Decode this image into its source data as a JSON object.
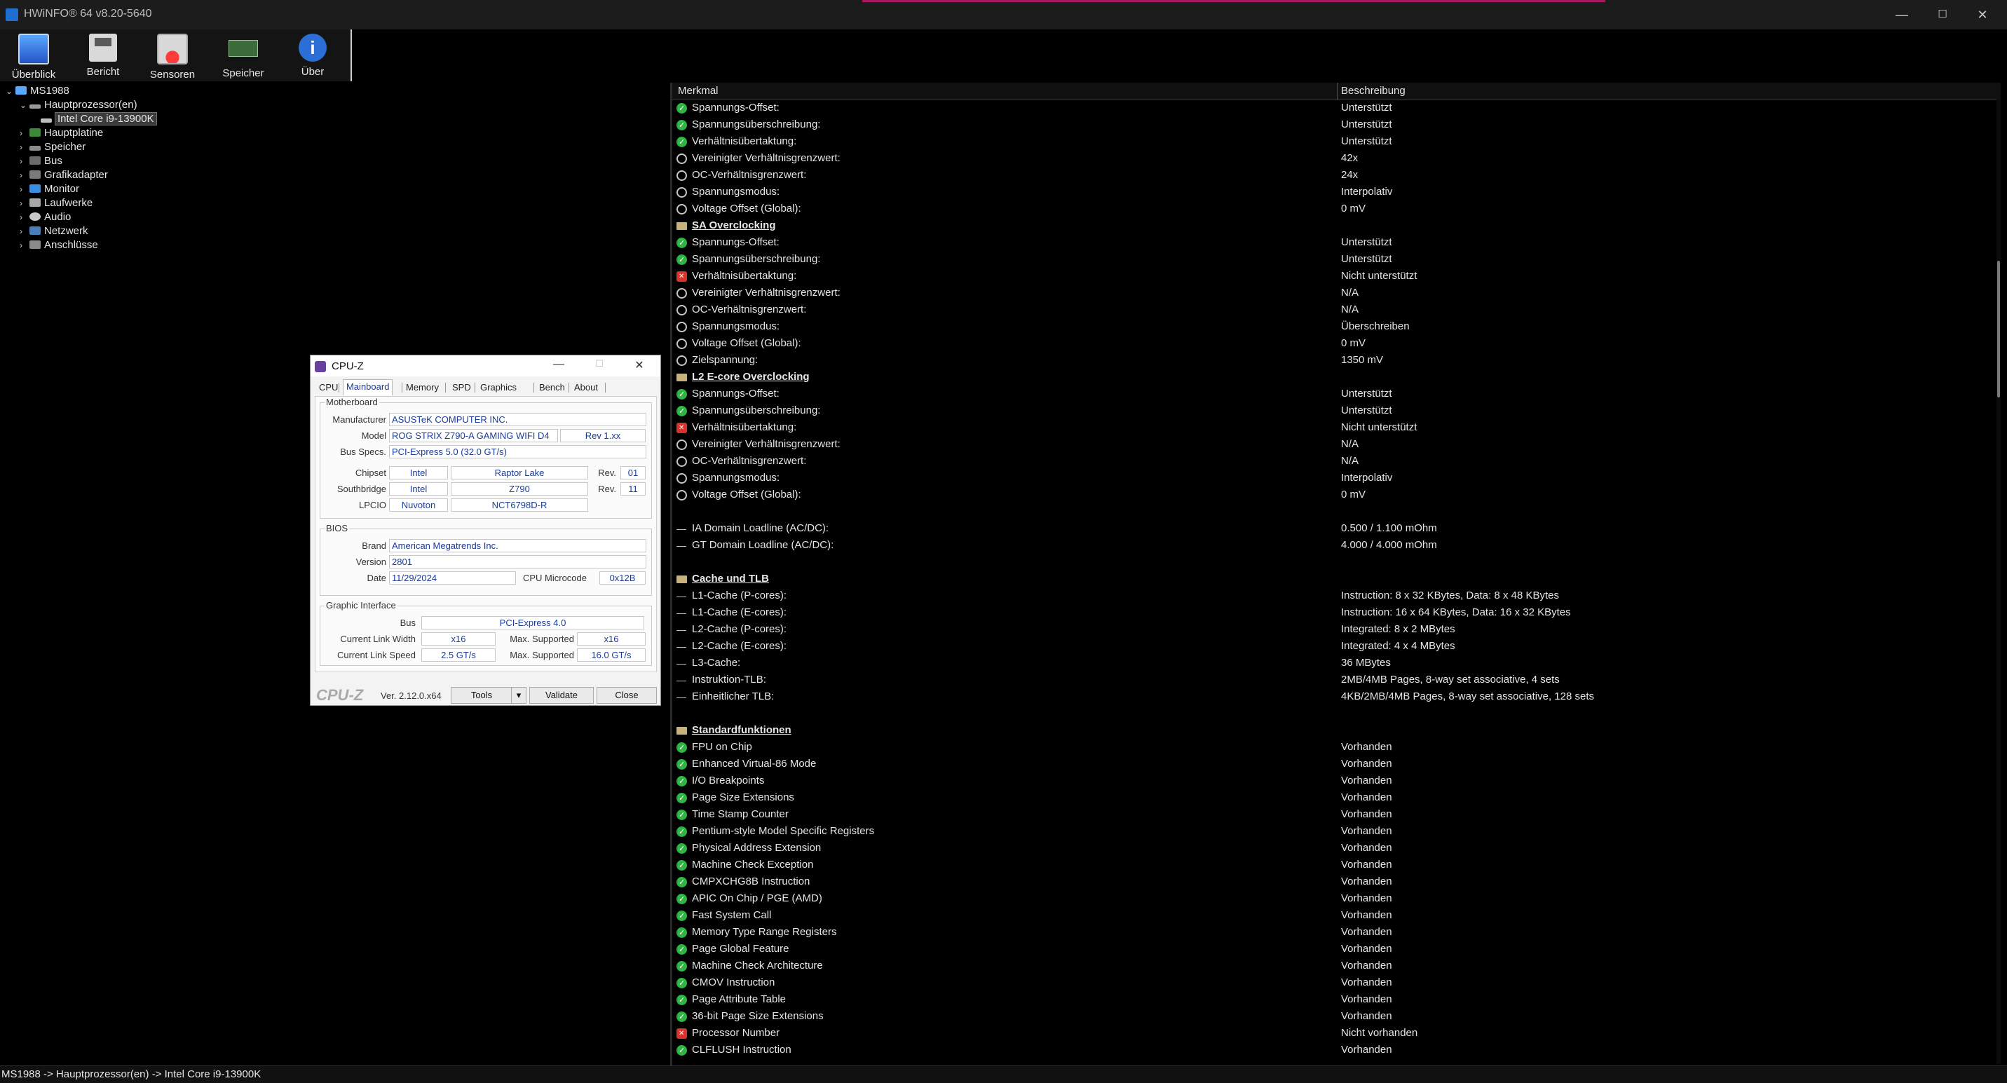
{
  "window": {
    "title": "HWiNFO® 64 v8.20-5640",
    "controls": {
      "minimize": "—",
      "maximize": "☐",
      "close": "✕"
    }
  },
  "toolbar": {
    "buttons": [
      {
        "label": "Überblick",
        "icon": "overview-icon"
      },
      {
        "label": "Bericht",
        "icon": "report-icon"
      },
      {
        "label": "Sensoren",
        "icon": "sensor-icon"
      },
      {
        "label": "Speicher",
        "icon": "memory-icon"
      },
      {
        "label": "Über",
        "icon": "about-icon",
        "glyph": "i"
      }
    ]
  },
  "tree": {
    "nodes": [
      {
        "label": "MS1988",
        "exp": "⌄"
      },
      {
        "label": "Hauptprozessor(en)",
        "exp": "⌄"
      },
      {
        "label": "Intel Core i9-13900K",
        "exp": ""
      },
      {
        "label": "Hauptplatine",
        "exp": "›"
      },
      {
        "label": "Speicher",
        "exp": "›"
      },
      {
        "label": "Bus",
        "exp": "›"
      },
      {
        "label": "Grafikadapter",
        "exp": "›"
      },
      {
        "label": "Monitor",
        "exp": "›"
      },
      {
        "label": "Laufwerke",
        "exp": "›"
      },
      {
        "label": "Audio",
        "exp": "›"
      },
      {
        "label": "Netzwerk",
        "exp": "›"
      },
      {
        "label": "Anschlüsse",
        "exp": "›"
      }
    ]
  },
  "table": {
    "headers": {
      "feature": "Merkmal",
      "description": "Beschreibung"
    },
    "rows": [
      {
        "icon": "ok",
        "k": "Spannungs-Offset:",
        "v": "Unterstützt"
      },
      {
        "icon": "ok",
        "k": "Spannungsüberschreibung:",
        "v": "Unterstützt"
      },
      {
        "icon": "ok",
        "k": "Verhältnisübertaktung:",
        "v": "Unterstützt"
      },
      {
        "icon": "clock",
        "k": "Vereinigter Verhältnisgrenzwert:",
        "v": "42x"
      },
      {
        "icon": "clock",
        "k": "OC-Verhältnisgrenzwert:",
        "v": "24x"
      },
      {
        "icon": "clock",
        "k": "Spannungsmodus:",
        "v": "Interpolativ"
      },
      {
        "icon": "clock",
        "k": "Voltage Offset (Global):",
        "v": "0 mV"
      },
      {
        "icon": "folder",
        "k": "SA Overclocking",
        "v": "",
        "section": true
      },
      {
        "icon": "ok",
        "k": "Spannungs-Offset:",
        "v": "Unterstützt"
      },
      {
        "icon": "ok",
        "k": "Spannungsüberschreibung:",
        "v": "Unterstützt"
      },
      {
        "icon": "no",
        "k": "Verhältnisübertaktung:",
        "v": "Nicht unterstützt"
      },
      {
        "icon": "clock",
        "k": "Vereinigter Verhältnisgrenzwert:",
        "v": "N/A"
      },
      {
        "icon": "clock",
        "k": "OC-Verhältnisgrenzwert:",
        "v": "N/A"
      },
      {
        "icon": "clock",
        "k": "Spannungsmodus:",
        "v": "Überschreiben"
      },
      {
        "icon": "clock",
        "k": "Voltage Offset (Global):",
        "v": "0 mV"
      },
      {
        "icon": "clock",
        "k": "Zielspannung:",
        "v": "1350 mV"
      },
      {
        "icon": "folder",
        "k": "L2 E-core Overclocking",
        "v": "",
        "section": true
      },
      {
        "icon": "ok",
        "k": "Spannungs-Offset:",
        "v": "Unterstützt"
      },
      {
        "icon": "ok",
        "k": "Spannungsüberschreibung:",
        "v": "Unterstützt"
      },
      {
        "icon": "no",
        "k": "Verhältnisübertaktung:",
        "v": "Nicht unterstützt"
      },
      {
        "icon": "clock",
        "k": "Vereinigter Verhältnisgrenzwert:",
        "v": "N/A"
      },
      {
        "icon": "clock",
        "k": "OC-Verhältnisgrenzwert:",
        "v": "N/A"
      },
      {
        "icon": "clock",
        "k": "Spannungsmodus:",
        "v": "Interpolativ"
      },
      {
        "icon": "clock",
        "k": "Voltage Offset (Global):",
        "v": "0 mV"
      },
      {
        "icon": "blank",
        "k": "",
        "v": ""
      },
      {
        "icon": "dash",
        "k": "IA Domain Loadline (AC/DC):",
        "v": "0.500 / 1.100 mOhm"
      },
      {
        "icon": "dash",
        "k": "GT Domain Loadline (AC/DC):",
        "v": "4.000 / 4.000 mOhm"
      },
      {
        "icon": "blank",
        "k": "",
        "v": ""
      },
      {
        "icon": "folder",
        "k": "Cache und TLB",
        "v": "",
        "section": true
      },
      {
        "icon": "dash",
        "k": "L1-Cache (P-cores):",
        "v": "Instruction: 8 x 32 KBytes, Data: 8 x 48 KBytes"
      },
      {
        "icon": "dash",
        "k": "L1-Cache (E-cores):",
        "v": "Instruction: 16 x 64 KBytes, Data: 16 x 32 KBytes"
      },
      {
        "icon": "dash",
        "k": "L2-Cache (P-cores):",
        "v": "Integrated: 8 x 2 MBytes"
      },
      {
        "icon": "dash",
        "k": "L2-Cache (E-cores):",
        "v": "Integrated: 4 x 4 MBytes"
      },
      {
        "icon": "dash",
        "k": "L3-Cache:",
        "v": "36 MBytes"
      },
      {
        "icon": "dash",
        "k": "Instruktion-TLB:",
        "v": "2MB/4MB Pages, 8-way set associative, 4 sets"
      },
      {
        "icon": "dash",
        "k": "Einheitlicher TLB:",
        "v": "4KB/2MB/4MB Pages, 8-way set associative, 128 sets"
      },
      {
        "icon": "blank",
        "k": "",
        "v": ""
      },
      {
        "icon": "folder",
        "k": "Standardfunktionen",
        "v": "",
        "section": true
      },
      {
        "icon": "ok",
        "k": "FPU on Chip",
        "v": "Vorhanden"
      },
      {
        "icon": "ok",
        "k": "Enhanced Virtual-86 Mode",
        "v": "Vorhanden"
      },
      {
        "icon": "ok",
        "k": "I/O Breakpoints",
        "v": "Vorhanden"
      },
      {
        "icon": "ok",
        "k": "Page Size Extensions",
        "v": "Vorhanden"
      },
      {
        "icon": "ok",
        "k": "Time Stamp Counter",
        "v": "Vorhanden"
      },
      {
        "icon": "ok",
        "k": "Pentium-style Model Specific Registers",
        "v": "Vorhanden"
      },
      {
        "icon": "ok",
        "k": "Physical Address Extension",
        "v": "Vorhanden"
      },
      {
        "icon": "ok",
        "k": "Machine Check Exception",
        "v": "Vorhanden"
      },
      {
        "icon": "ok",
        "k": "CMPXCHG8B Instruction",
        "v": "Vorhanden"
      },
      {
        "icon": "ok",
        "k": "APIC On Chip / PGE (AMD)",
        "v": "Vorhanden"
      },
      {
        "icon": "ok",
        "k": "Fast System Call",
        "v": "Vorhanden"
      },
      {
        "icon": "ok",
        "k": "Memory Type Range Registers",
        "v": "Vorhanden"
      },
      {
        "icon": "ok",
        "k": "Page Global Feature",
        "v": "Vorhanden"
      },
      {
        "icon": "ok",
        "k": "Machine Check Architecture",
        "v": "Vorhanden"
      },
      {
        "icon": "ok",
        "k": "CMOV Instruction",
        "v": "Vorhanden"
      },
      {
        "icon": "ok",
        "k": "Page Attribute Table",
        "v": "Vorhanden"
      },
      {
        "icon": "ok",
        "k": "36-bit Page Size Extensions",
        "v": "Vorhanden"
      },
      {
        "icon": "no",
        "k": "Processor Number",
        "v": "Nicht vorhanden"
      },
      {
        "icon": "ok",
        "k": "CLFLUSH Instruction",
        "v": "Vorhanden"
      }
    ]
  },
  "statusbar": {
    "path": "MS1988 -> Hauptprozessor(en) -> Intel Core i9-13900K"
  },
  "cpuz": {
    "title": "CPU-Z",
    "controls": {
      "minimize": "—",
      "maximize": "☐",
      "close": "✕"
    },
    "tabs": [
      "CPU",
      "Mainboard",
      "Memory",
      "SPD",
      "Graphics",
      "Bench",
      "About"
    ],
    "active_tab": "Mainboard",
    "motherboard": {
      "group": "Motherboard",
      "manufacturer_label": "Manufacturer",
      "manufacturer": "ASUSTeK COMPUTER INC.",
      "model_label": "Model",
      "model": "ROG STRIX Z790-A GAMING WIFI D4",
      "model_rev": "Rev 1.xx",
      "busspecs_label": "Bus Specs.",
      "busspecs": "PCI-Express 5.0 (32.0 GT/s)",
      "chipset_label": "Chipset",
      "chipset_vendor": "Intel",
      "chipset_name": "Raptor Lake",
      "chipset_rev_label": "Rev.",
      "chipset_rev": "01",
      "southbridge_label": "Southbridge",
      "sb_vendor": "Intel",
      "sb_name": "Z790",
      "sb_rev_label": "Rev.",
      "sb_rev": "11",
      "lpcio_label": "LPCIO",
      "lpcio_vendor": "Nuvoton",
      "lpcio_name": "NCT6798D-R"
    },
    "bios": {
      "group": "BIOS",
      "brand_label": "Brand",
      "brand": "American Megatrends Inc.",
      "version_label": "Version",
      "version": "2801",
      "date_label": "Date",
      "date": "11/29/2024",
      "microcode_label": "CPU Microcode",
      "microcode": "0x12B"
    },
    "graphic": {
      "group": "Graphic Interface",
      "bus_label": "Bus",
      "bus": "PCI-Express 4.0",
      "clw_label": "Current Link Width",
      "clw": "x16",
      "ms1_label": "Max. Supported",
      "ms1": "x16",
      "cls_label": "Current Link Speed",
      "cls": "2.5 GT/s",
      "ms2_label": "Max. Supported",
      "ms2": "16.0 GT/s"
    },
    "footer": {
      "logo": "CPU-Z",
      "version": "Ver. 2.12.0.x64",
      "tools": "Tools",
      "tools_arrow": "▾",
      "validate": "Validate",
      "close": "Close"
    }
  },
  "colors": {
    "ok": "#2fb544",
    "not_supported": "#d9342b",
    "tree_selected": "#3b3b3b",
    "cpuz_value": "#1b3c99"
  }
}
